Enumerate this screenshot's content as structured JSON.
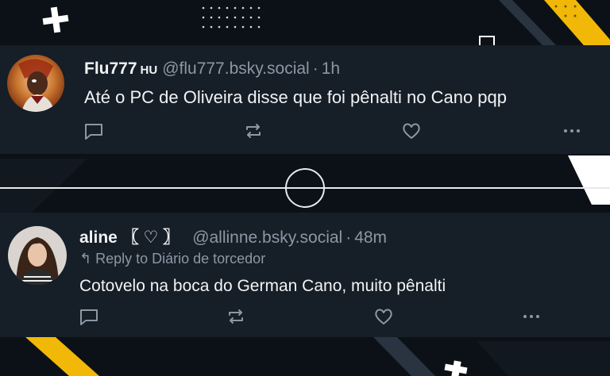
{
  "posts": [
    {
      "display_name": "Flu777",
      "badge": "HU",
      "handle": "@flu777.bsky.social",
      "separator": "·",
      "time": "1h",
      "text": "Até o PC de Oliveira disse que foi pênalti no Cano pqp"
    },
    {
      "display_name": "aline 〖 ♡ 〗",
      "handle": "@allinne.bsky.social",
      "separator": "·",
      "time": "48m",
      "reply_to": "↰ Reply to Diário de torcedor",
      "text": "Cotovelo na boca do German Cano, muito pênalti"
    }
  ],
  "colors": {
    "background": "#0c1117",
    "post_background": "#161e27",
    "text": "#f1f3f5",
    "muted": "#8b98a5",
    "accent_yellow": "#f2b807"
  },
  "icons": [
    "reply-icon",
    "repost-icon",
    "like-icon",
    "more-icon"
  ]
}
